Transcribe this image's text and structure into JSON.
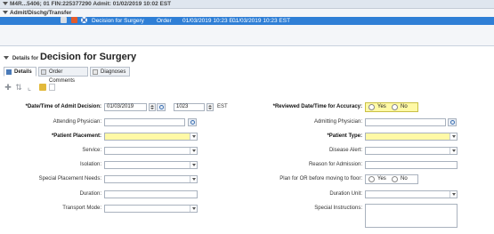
{
  "banner": {
    "patient_line": "M4R...5406; 01 FIN:225377290 Admit: 01/02/2019 10:02 EST",
    "section": "Admit/Dischg/Transfer"
  },
  "selected_row": {
    "name": "Decision for Surgery",
    "type": "Order",
    "start": "01/03/2019 10:23 E...",
    "end": "01/03/2019 10:23 EST"
  },
  "details": {
    "prefix": "Details for",
    "title": "Decision for Surgery"
  },
  "tabs": [
    {
      "label": "Details"
    },
    {
      "label": "Order Comments"
    },
    {
      "label": "Diagnoses"
    }
  ],
  "form": {
    "admit_decision_label": "*Date/Time of Admit Decision:",
    "admit_date": "01/03/2019",
    "admit_time": "1023",
    "admit_tz": "EST",
    "reviewed_label": "*Reviewed Date/Time for Accuracy:",
    "yes": "Yes",
    "no": "No",
    "attending_label": "Attending Physician:",
    "admitting_label": "Admitting Physician:",
    "placement_label": "*Patient Placement:",
    "patient_type_label": "*Patient Type:",
    "service_label": "Service:",
    "disease_alert_label": "Disease Alert:",
    "isolation_label": "Isolation:",
    "reason_label": "Reason for Admission:",
    "special_placement_label": "Special Placement Needs:",
    "plan_or_label": "Plan for OR before moving to floor:",
    "duration_label": "Duration:",
    "duration_unit_label": "Duration Unit:",
    "transport_label": "Transport Mode:",
    "special_instr_label": "Special Instructions:"
  },
  "colors": {
    "required_field": "#fff9a6",
    "selected_row": "#2f7fd6"
  }
}
